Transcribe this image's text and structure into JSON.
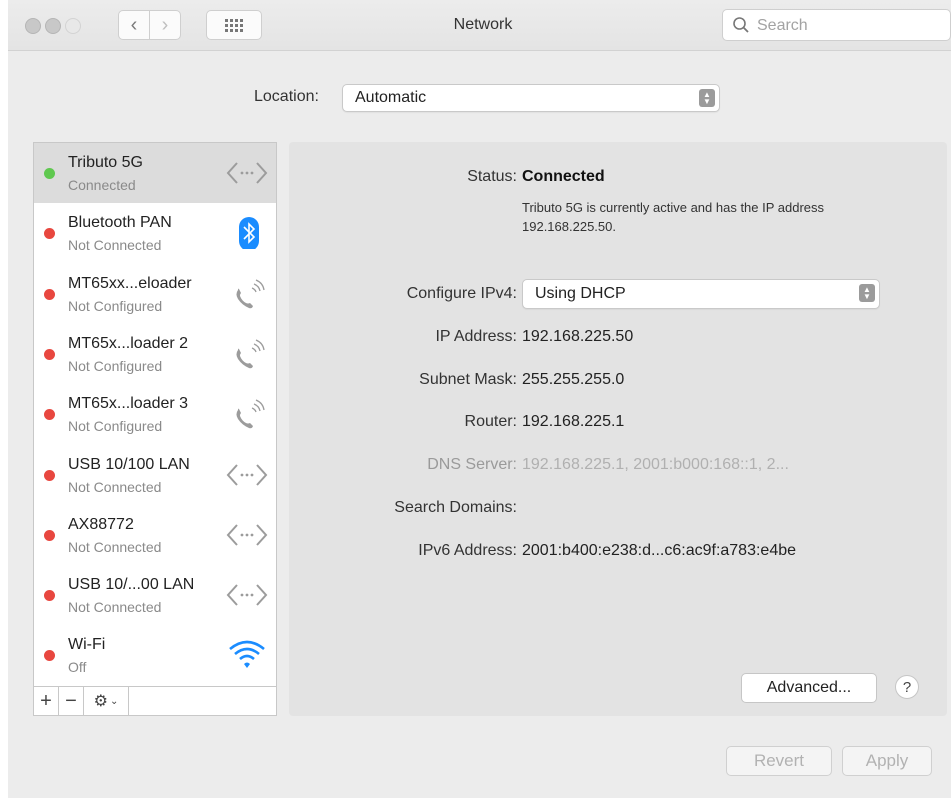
{
  "window": {
    "title": "Network"
  },
  "search": {
    "placeholder": "Search"
  },
  "location": {
    "label": "Location:",
    "value": "Automatic"
  },
  "services": [
    {
      "name": "Tributo 5G",
      "status": "Connected",
      "state": "connected",
      "icon": "ethernet-arrows-icon"
    },
    {
      "name": "Bluetooth PAN",
      "status": "Not Connected",
      "state": "error",
      "icon": "bluetooth-icon"
    },
    {
      "name": "MT65xx...eloader",
      "status": "Not Configured",
      "state": "error",
      "icon": "phone-icon"
    },
    {
      "name": "MT65x...loader 2",
      "status": "Not Configured",
      "state": "error",
      "icon": "phone-icon"
    },
    {
      "name": "MT65x...loader 3",
      "status": "Not Configured",
      "state": "error",
      "icon": "phone-icon"
    },
    {
      "name": "USB 10/100 LAN",
      "status": "Not Connected",
      "state": "error",
      "icon": "ethernet-arrows-icon"
    },
    {
      "name": "AX88772",
      "status": "Not Connected",
      "state": "error",
      "icon": "ethernet-arrows-icon"
    },
    {
      "name": "USB 10/...00 LAN",
      "status": "Not Connected",
      "state": "error",
      "icon": "ethernet-arrows-icon"
    },
    {
      "name": "Wi-Fi",
      "status": "Off",
      "state": "error",
      "icon": "wifi-icon"
    }
  ],
  "list_tools": {
    "add": "+",
    "remove": "−"
  },
  "detail": {
    "status_label": "Status:",
    "status_value": "Connected",
    "status_description": "Tributo 5G is currently active and has the IP address 192.168.225.50.",
    "configure_label": "Configure IPv4:",
    "configure_value": "Using DHCP",
    "ip_label": "IP Address:",
    "ip_value": "192.168.225.50",
    "subnet_label": "Subnet Mask:",
    "subnet_value": "255.255.255.0",
    "router_label": "Router:",
    "router_value": "192.168.225.1",
    "dns_label": "DNS Server:",
    "dns_value": "192.168.225.1, 2001:b000:168::1, 2...",
    "search_domains_label": "Search Domains:",
    "ipv6_label": "IPv6 Address:",
    "ipv6_value": "2001:b400:e238:d...c6:ac9f:a783:e4be",
    "advanced_label": "Advanced...",
    "help_label": "?"
  },
  "footer": {
    "revert_label": "Revert",
    "apply_label": "Apply"
  },
  "colors": {
    "connected": "#5fc84f",
    "error": "#e8473f",
    "accent_blue": "#1a8cff"
  }
}
